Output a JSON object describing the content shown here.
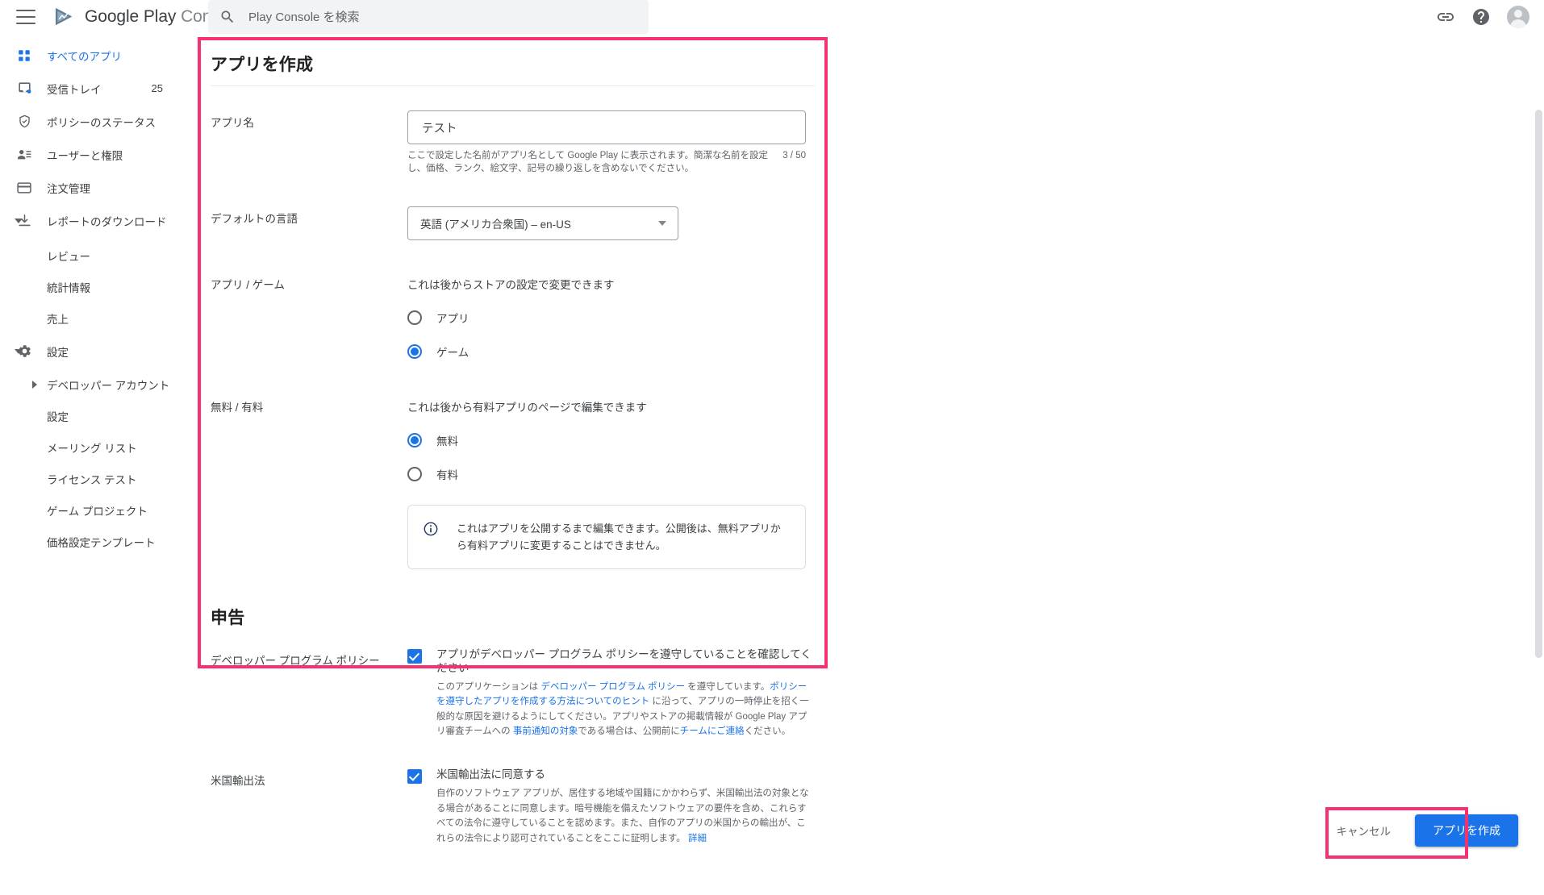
{
  "app": {
    "brand_strong": "Google Play",
    "brand_light": "Console"
  },
  "search": {
    "placeholder": "Play Console を検索",
    "value": ""
  },
  "sidebar": {
    "items": [
      {
        "label": "すべてのアプリ",
        "icon": "apps-grid-icon",
        "badge": "",
        "active": true
      },
      {
        "label": "受信トレイ",
        "icon": "inbox-icon",
        "badge": "25",
        "active": false
      },
      {
        "label": "ポリシーのステータス",
        "icon": "shield-check-icon",
        "badge": "",
        "active": false
      },
      {
        "label": "ユーザーと権限",
        "icon": "user-permissions-icon",
        "badge": "",
        "active": false
      },
      {
        "label": "注文管理",
        "icon": "credit-card-icon",
        "badge": "",
        "active": false
      },
      {
        "label": "レポートのダウンロード",
        "icon": "download-icon",
        "badge": "",
        "active": false
      },
      {
        "label": "レビュー",
        "icon": "",
        "badge": "",
        "active": false
      },
      {
        "label": "統計情報",
        "icon": "",
        "badge": "",
        "active": false
      },
      {
        "label": "売上",
        "icon": "",
        "badge": "",
        "active": false
      },
      {
        "label": "設定",
        "icon": "gear-icon",
        "badge": "",
        "active": false
      },
      {
        "label": "デベロッパー アカウント",
        "icon": "",
        "badge": "",
        "active": false
      },
      {
        "label": "設定",
        "icon": "",
        "badge": "",
        "active": false
      },
      {
        "label": "メーリング リスト",
        "icon": "",
        "badge": "",
        "active": false
      },
      {
        "label": "ライセンス テスト",
        "icon": "",
        "badge": "",
        "active": false
      },
      {
        "label": "ゲーム プロジェクト",
        "icon": "",
        "badge": "",
        "active": false
      },
      {
        "label": "価格設定テンプレート",
        "icon": "",
        "badge": "",
        "active": false
      }
    ]
  },
  "form": {
    "title": "アプリを作成",
    "app_name": {
      "label": "アプリ名",
      "value": "テスト",
      "placeholder": "",
      "helper": "ここで設定した名前がアプリ名として Google Play に表示されます。簡潔な名前を設定し、価格、ランク、絵文字、記号の繰り返しを含めないでください。",
      "counter": "3 / 50"
    },
    "default_language": {
      "label": "デフォルトの言語",
      "value": "英語 (アメリカ合衆国) – en-US"
    },
    "app_or_game": {
      "label": "アプリ / ゲーム",
      "hint": "これは後からストアの設定で変更できます",
      "options": [
        {
          "label": "アプリ",
          "checked": false
        },
        {
          "label": "ゲーム",
          "checked": true
        }
      ]
    },
    "free_or_paid": {
      "label": "無料 / 有料",
      "hint": "これは後から有料アプリのページで編集できます",
      "options": [
        {
          "label": "無料",
          "checked": true
        },
        {
          "label": "有料",
          "checked": false
        }
      ],
      "callout": "これはアプリを公開するまで編集できます。公開後は、無料アプリから有料アプリに変更することはできません。"
    }
  },
  "declarations": {
    "title": "申告",
    "developer_policy": {
      "label": "デベロッパー プログラム ポリシー",
      "checked": true,
      "checkbox_title": "アプリがデベロッパー プログラム ポリシーを遵守していることを確認してください",
      "desc_part1": "このアプリケーションは ",
      "link1": "デベロッパー プログラム ポリシー",
      "desc_part2": " を遵守しています。",
      "link2": "ポリシーを遵守したアプリを作成する方法についてのヒント",
      "desc_part3": " に沿って、アプリの一時停止を招く一般的な原因を避けるようにしてください。アプリやストアの掲載情報が Google Play アプリ審査チームへの ",
      "link3": "事前通知の対象",
      "desc_part4": "である場合は、公開前に",
      "link4": "チームにご連絡",
      "desc_part5": "ください。"
    },
    "us_export": {
      "label": "米国輸出法",
      "checked": true,
      "checkbox_title": "米国輸出法に同意する",
      "desc": "自作のソフトウェア アプリが、居住する地域や国籍にかかわらず、米国輸出法の対象となる場合があることに同意します。暗号機能を備えたソフトウェアの要件を含め、これらすべての法令に遵守していることを認めます。また、自作のアプリの米国からの輸出が、これらの法令により認可されていることをここに証明します。",
      "link": "詳細"
    }
  },
  "footer": {
    "cancel_label": "キャンセル",
    "submit_label": "アプリを作成"
  },
  "colors": {
    "accent_blue": "#1a73e8",
    "annotation_pink": "#f5316f",
    "text_primary": "#3c4043",
    "text_secondary": "#5f6368"
  }
}
